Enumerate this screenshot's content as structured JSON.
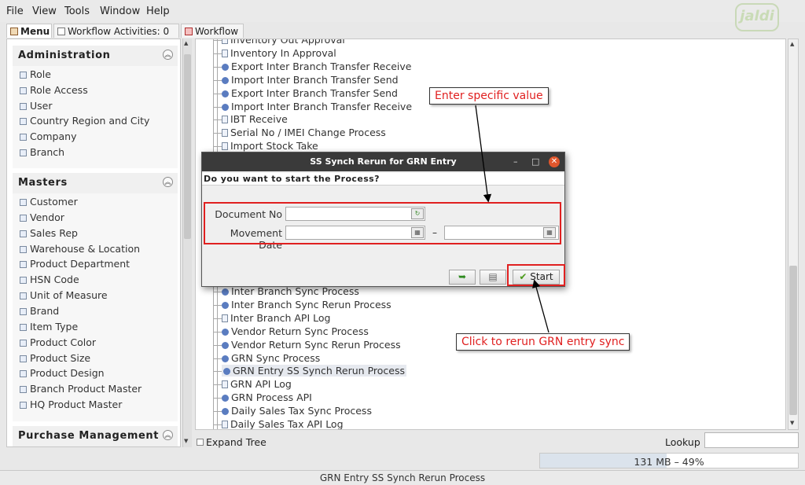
{
  "menu": [
    "File",
    "View",
    "Tools",
    "Window",
    "Help"
  ],
  "logo_text": "jaldi",
  "tabs": {
    "menu_label": "Menu",
    "activities_label": "Workflow Activities: 0",
    "workflow_label": "Workflow"
  },
  "sidebar": {
    "administration": {
      "title": "Administration",
      "items": [
        "Role",
        "Role Access",
        "User",
        "Country Region and City",
        "Company",
        "Branch"
      ]
    },
    "masters": {
      "title": "Masters",
      "items": [
        "Customer",
        "Vendor",
        "Sales Rep",
        "Warehouse & Location",
        "Product Department",
        "HSN Code",
        "Unit of Measure",
        "Brand",
        "Item Type",
        "Product Color",
        "Product Size",
        "Product Design",
        "Branch Product Master",
        "HQ Product Master"
      ]
    },
    "purchase": {
      "title": "Purchase Management"
    }
  },
  "tree": {
    "items_top": [
      {
        "icon": "doc",
        "label": "Inventory Out Approval"
      },
      {
        "icon": "doc",
        "label": "Inventory In Approval"
      },
      {
        "icon": "gear",
        "label": "Export Inter Branch Transfer Receive"
      },
      {
        "icon": "gear",
        "label": "Import Inter Branch Transfer Send"
      },
      {
        "icon": "gear",
        "label": "Export Inter Branch Transfer Send"
      },
      {
        "icon": "gear",
        "label": "Import Inter Branch Transfer Receive"
      },
      {
        "icon": "doc",
        "label": "IBT Receive"
      },
      {
        "icon": "doc",
        "label": "Serial No / IMEI Change Process"
      },
      {
        "icon": "doc",
        "label": "Import Stock Take"
      }
    ],
    "items_bottom": [
      {
        "icon": "gear",
        "label": "Inter Branch Sync Process"
      },
      {
        "icon": "gear",
        "label": "Inter Branch Sync Rerun Process"
      },
      {
        "icon": "doc",
        "label": "Inter Branch API Log"
      },
      {
        "icon": "gear",
        "label": "Vendor Return Sync Process"
      },
      {
        "icon": "gear",
        "label": "Vendor Return Sync Rerun Process"
      },
      {
        "icon": "gear",
        "label": "GRN Sync Process"
      },
      {
        "icon": "gear",
        "label": "GRN Entry SS Synch Rerun Process"
      },
      {
        "icon": "doc",
        "label": "GRN API Log"
      },
      {
        "icon": "gear",
        "label": "GRN Process API"
      },
      {
        "icon": "gear",
        "label": "Daily Sales Tax Sync Process"
      },
      {
        "icon": "doc",
        "label": "Daily Sales Tax API Log"
      }
    ],
    "selected": "GRN Entry SS Synch Rerun Process",
    "expand_tree_label": "Expand Tree",
    "lookup_label": "Lookup",
    "lookup_value": ""
  },
  "memory": "131 MB – 49%",
  "status_text": "GRN Entry SS Synch Rerun Process",
  "dialog": {
    "title": "SS Synch Rerun for GRN Entry",
    "question": "Do you want to start the Process?",
    "doc_no_label": "Document No",
    "doc_no_value": "",
    "movement_date_label": "Movement Date",
    "date_from": "",
    "date_to": "",
    "dash": "–",
    "start_label": "Start"
  },
  "annotations": {
    "enter_value": "Enter specific value",
    "click_rerun": "Click to rerun GRN entry sync"
  },
  "colors": {
    "annotation_red": "#e02020",
    "dialog_title_bg": "#3a3a3a"
  }
}
